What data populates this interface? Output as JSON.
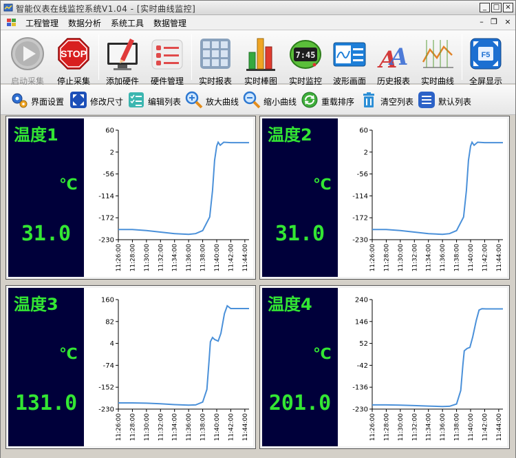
{
  "window": {
    "title": "智能仪表在线监控系统V1.04 - [实时曲线监控]",
    "controls": {
      "minimize": "_",
      "maximize": "□",
      "close": "×"
    }
  },
  "menubar": {
    "items": [
      "工程管理",
      "数据分析",
      "系统工具",
      "数据管理"
    ],
    "mdi": {
      "minimize": "–",
      "restore": "❐",
      "close": "×"
    }
  },
  "toolbar_main": [
    {
      "label": "启动采集",
      "icon": "play-icon",
      "enabled": false
    },
    {
      "label": "停止采集",
      "icon": "stop-sign-icon",
      "enabled": true
    },
    {
      "label": "添加硬件",
      "icon": "monitor-pencil-icon",
      "enabled": true
    },
    {
      "label": "硬件管理",
      "icon": "list-icon",
      "enabled": true
    },
    {
      "label": "实时报表",
      "icon": "grid-table-icon",
      "enabled": true
    },
    {
      "label": "实时棒图",
      "icon": "bar-chart-icon",
      "enabled": true
    },
    {
      "label": "实时监控",
      "icon": "digital-clock-icon",
      "enabled": true
    },
    {
      "label": "波形画面",
      "icon": "waveform-icon",
      "enabled": true
    },
    {
      "label": "历史报表",
      "icon": "history-report-icon",
      "enabled": true
    },
    {
      "label": "实时曲线",
      "icon": "line-curve-icon",
      "enabled": true
    },
    {
      "label": "全屏显示",
      "icon": "fullscreen-f5-icon",
      "enabled": true
    }
  ],
  "toolbar_secondary": [
    {
      "label": "界面设置",
      "icon": "gears-icon"
    },
    {
      "label": "修改尺寸",
      "icon": "resize-icon"
    },
    {
      "label": "编辑列表",
      "icon": "edit-list-icon"
    },
    {
      "label": "放大曲线",
      "icon": "zoom-in-icon"
    },
    {
      "label": "缩小曲线",
      "icon": "zoom-out-icon"
    },
    {
      "label": "重载排序",
      "icon": "reload-icon"
    },
    {
      "label": "清空列表",
      "icon": "trash-icon"
    },
    {
      "label": "默认列表",
      "icon": "default-list-icon"
    }
  ],
  "colors": {
    "panel_bg": "#00003a",
    "panel_text": "#33e633",
    "curve": "#4a90d9"
  },
  "chart_data": [
    {
      "type": "line",
      "name": "温度1",
      "unit": "℃",
      "current_value": "31.0",
      "yticks": [
        "60",
        "2",
        "-56",
        "-114",
        "-172",
        "-230"
      ],
      "ylim": [
        -230,
        60
      ],
      "xticks": [
        "11:26:00",
        "11:28:00",
        "11:30:00",
        "11:32:00",
        "11:34:00",
        "11:36:00",
        "11:38:00",
        "11:40:00",
        "11:42:00",
        "11:44:00"
      ],
      "x_minutes": [
        0,
        2,
        4,
        6,
        8,
        10,
        11,
        12,
        13,
        13.4,
        13.7,
        14,
        14.2,
        14.5,
        15,
        16,
        17,
        18.6
      ],
      "y": [
        -203,
        -203,
        -206,
        -210,
        -214,
        -216,
        -214,
        -206,
        -170,
        -100,
        -20,
        18,
        28,
        20,
        28,
        27,
        27,
        27
      ]
    },
    {
      "type": "line",
      "name": "温度2",
      "unit": "℃",
      "current_value": "31.0",
      "yticks": [
        "60",
        "2",
        "-56",
        "-114",
        "-172",
        "-230"
      ],
      "ylim": [
        -230,
        60
      ],
      "xticks": [
        "11:26:00",
        "11:28:00",
        "11:30:00",
        "11:32:00",
        "11:34:00",
        "11:36:00",
        "11:38:00",
        "11:40:00",
        "11:42:00",
        "11:44:00"
      ],
      "x_minutes": [
        0,
        2,
        4,
        6,
        8,
        10,
        11,
        12,
        13,
        13.4,
        13.7,
        14,
        14.2,
        14.5,
        15,
        16,
        17,
        18.6
      ],
      "y": [
        -203,
        -203,
        -206,
        -210,
        -214,
        -216,
        -214,
        -206,
        -170,
        -100,
        -20,
        18,
        28,
        20,
        28,
        27,
        27,
        27
      ]
    },
    {
      "type": "line",
      "name": "温度3",
      "unit": "℃",
      "current_value": "131.0",
      "yticks": [
        "160",
        "82",
        "4",
        "-74",
        "-152",
        "-230"
      ],
      "ylim": [
        -230,
        160
      ],
      "xticks": [
        "11:26:00",
        "11:28:00",
        "11:30:00",
        "11:32:00",
        "11:34:00",
        "11:36:00",
        "11:38:00",
        "11:40:00",
        "11:42:00",
        "11:44:00"
      ],
      "x_minutes": [
        0,
        2,
        4,
        6,
        8,
        10,
        11,
        12,
        12.6,
        12.9,
        13.1,
        13.4,
        13.7,
        14.2,
        14.6,
        15.1,
        15.5,
        16,
        17,
        18.6
      ],
      "y": [
        -208,
        -208,
        -209,
        -211,
        -214,
        -216,
        -215,
        -205,
        -160,
        -60,
        10,
        25,
        18,
        12,
        40,
        110,
        138,
        128,
        128,
        128
      ]
    },
    {
      "type": "line",
      "name": "温度4",
      "unit": "℃",
      "current_value": "201.0",
      "yticks": [
        "240",
        "146",
        "52",
        "-42",
        "-136",
        "-230"
      ],
      "ylim": [
        -230,
        240
      ],
      "xticks": [
        "11:26:00",
        "11:28:00",
        "11:30:00",
        "11:32:00",
        "11:34:00",
        "11:36:00",
        "11:38:00",
        "11:40:00",
        "11:42:00",
        "11:44:00"
      ],
      "x_minutes": [
        0,
        2,
        4,
        6,
        8,
        10,
        11,
        12,
        12.6,
        12.9,
        13.1,
        13.5,
        13.9,
        14.3,
        14.8,
        15.2,
        15.6,
        16.2,
        17,
        18.6
      ],
      "y": [
        -212,
        -212,
        -213,
        -215,
        -217,
        -219,
        -218,
        -208,
        -150,
        -40,
        20,
        30,
        35,
        80,
        150,
        195,
        201,
        200,
        200,
        200
      ]
    }
  ]
}
